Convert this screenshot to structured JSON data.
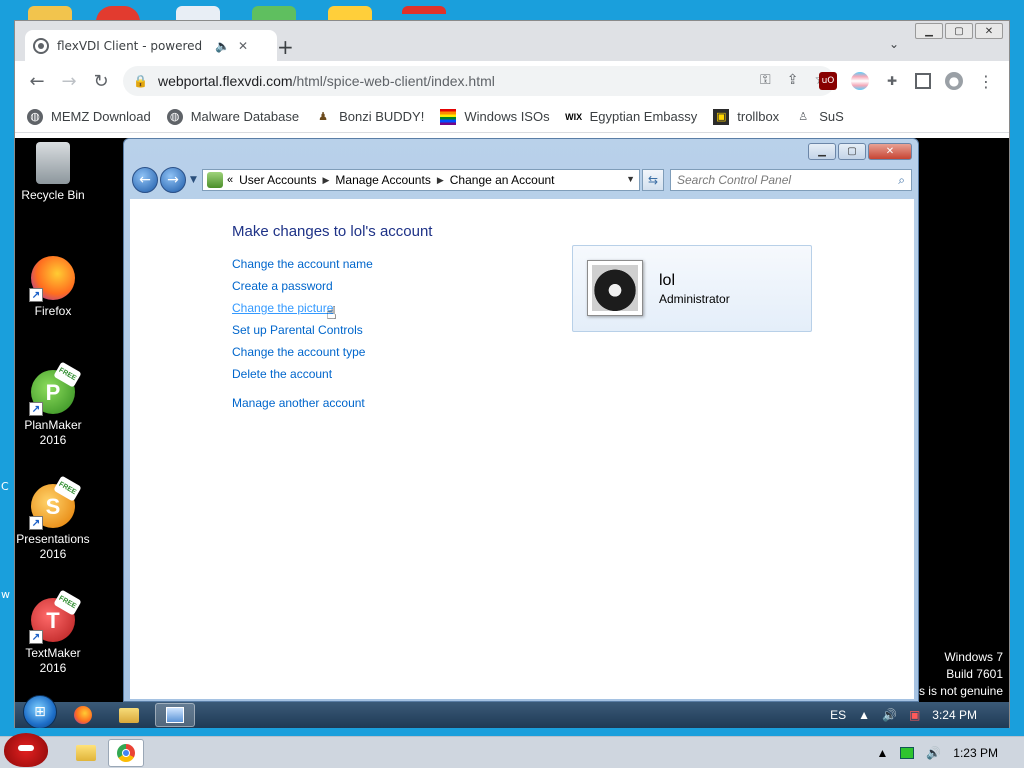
{
  "browser": {
    "tab_title": "flexVDI Client - powered b",
    "url_host": "webportal.flexvdi.com",
    "url_path": "/html/spice-web-client/index.html",
    "bookmarks": [
      {
        "label": "MEMZ Download",
        "icon": "globe-icon"
      },
      {
        "label": "Malware Database",
        "icon": "globe-icon"
      },
      {
        "label": "Bonzi BUDDY!",
        "icon": "bonzi-icon"
      },
      {
        "label": "Windows ISOs",
        "icon": "rainbow-flag-icon"
      },
      {
        "label": "Egyptian Embassy",
        "icon": "wix-icon"
      },
      {
        "label": "trollbox",
        "icon": "trollbox-icon"
      },
      {
        "label": "SuS",
        "icon": "sus-icon"
      }
    ]
  },
  "remote": {
    "desktop_icons": [
      {
        "label": "Recycle Bin",
        "icon": "recycle-bin-icon"
      },
      {
        "label": "Firefox",
        "icon": "firefox-icon"
      },
      {
        "label": "PlanMaker 2016",
        "icon": "planmaker-icon"
      },
      {
        "label": "Presentations 2016",
        "icon": "presentations-icon"
      },
      {
        "label": "TextMaker 2016",
        "icon": "textmaker-icon"
      }
    ],
    "build_line1": "Windows 7",
    "build_line2": "Build 7601",
    "build_line3": "s is not genuine",
    "control_panel": {
      "breadcrumb": [
        "User Accounts",
        "Manage Accounts",
        "Change an Account"
      ],
      "search_placeholder": "Search Control Panel",
      "heading": "Make changes to lol's account",
      "links": [
        "Change the account name",
        "Create a password",
        "Change the picture",
        "Set up Parental Controls",
        "Change the account type",
        "Delete the account"
      ],
      "manage_link": "Manage another account",
      "account_name": "lol",
      "account_role": "Administrator"
    },
    "taskbar": {
      "lang": "ES",
      "time": "3:24 PM"
    }
  },
  "host_taskbar": {
    "time": "1:23 PM"
  }
}
